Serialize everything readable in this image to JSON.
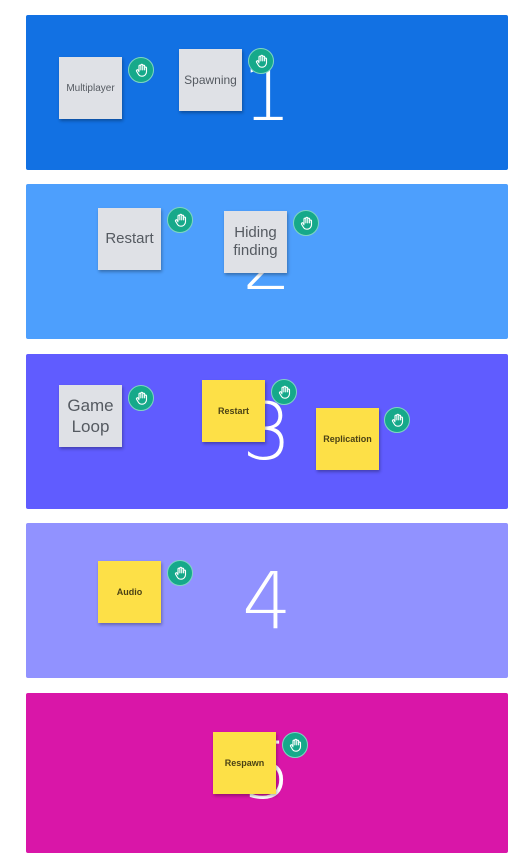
{
  "boards": [
    {
      "number": "1",
      "color": "#1271e3",
      "notes": [
        {
          "text": "Multiplayer",
          "color": "grey"
        },
        {
          "text": "Spawning",
          "color": "grey"
        }
      ]
    },
    {
      "number": "2",
      "color": "#4d9ffd",
      "notes": [
        {
          "text": "Restart",
          "color": "grey"
        },
        {
          "text": "Hiding finding",
          "color": "grey"
        }
      ]
    },
    {
      "number": "3",
      "color": "#605cff",
      "notes": [
        {
          "text": "Game Loop",
          "color": "grey"
        },
        {
          "text": "Restart",
          "color": "yellow"
        },
        {
          "text": "Replication",
          "color": "yellow"
        }
      ]
    },
    {
      "number": "4",
      "color": "#9192ff",
      "notes": [
        {
          "text": "Audio",
          "color": "yellow"
        }
      ]
    },
    {
      "number": "5",
      "color": "#d916a8",
      "notes": [
        {
          "text": "Respawn",
          "color": "yellow"
        }
      ]
    }
  ],
  "icons": {
    "grab": "hand-icon"
  },
  "accent": "#16a98a"
}
